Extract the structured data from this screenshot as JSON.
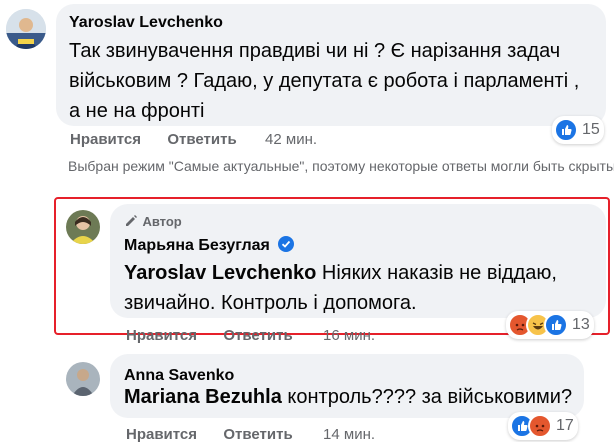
{
  "comments": [
    {
      "author": "Yaroslav Levchenko",
      "text": "Так звинувачення правдиві чи ні ? Є нарізання задач військовим ? Гадаю, у депутата є робота і парламенті , а не на фронті",
      "like_label": "Нравится",
      "reply_label": "Ответить",
      "time": "42 мин.",
      "reactions_count": "15"
    },
    {
      "badge": "Автор",
      "author": "Марьяна Безуглая",
      "tagged": "Yaroslav Levchenko",
      "text": "Ніяких наказів не віддаю, звичайно. Контроль і допомога.",
      "like_label": "Нравится",
      "reply_label": "Ответить",
      "time": "16 мин.",
      "reactions_count": "13"
    },
    {
      "author": "Anna Savenko",
      "tagged": "Mariana Bezuhla",
      "text": "контроль???? за військовими?",
      "like_label": "Нравится",
      "reply_label": "Ответить",
      "time": "14 мин.",
      "reactions_count": "17"
    }
  ],
  "notice": "Выбран режим \"Самые актуальные\", поэтому некоторые ответы могли быть скрыты.",
  "colors": {
    "bubble": "#f0f2f5",
    "like": "#1b74e4",
    "highlight": "#e6202a",
    "secondary_text": "#65676b"
  },
  "icons": {
    "like": "like-reaction-icon",
    "angry": "angry-reaction-icon",
    "haha": "haha-reaction-icon",
    "pencil": "pencil-icon",
    "verified": "verified-badge-icon"
  }
}
